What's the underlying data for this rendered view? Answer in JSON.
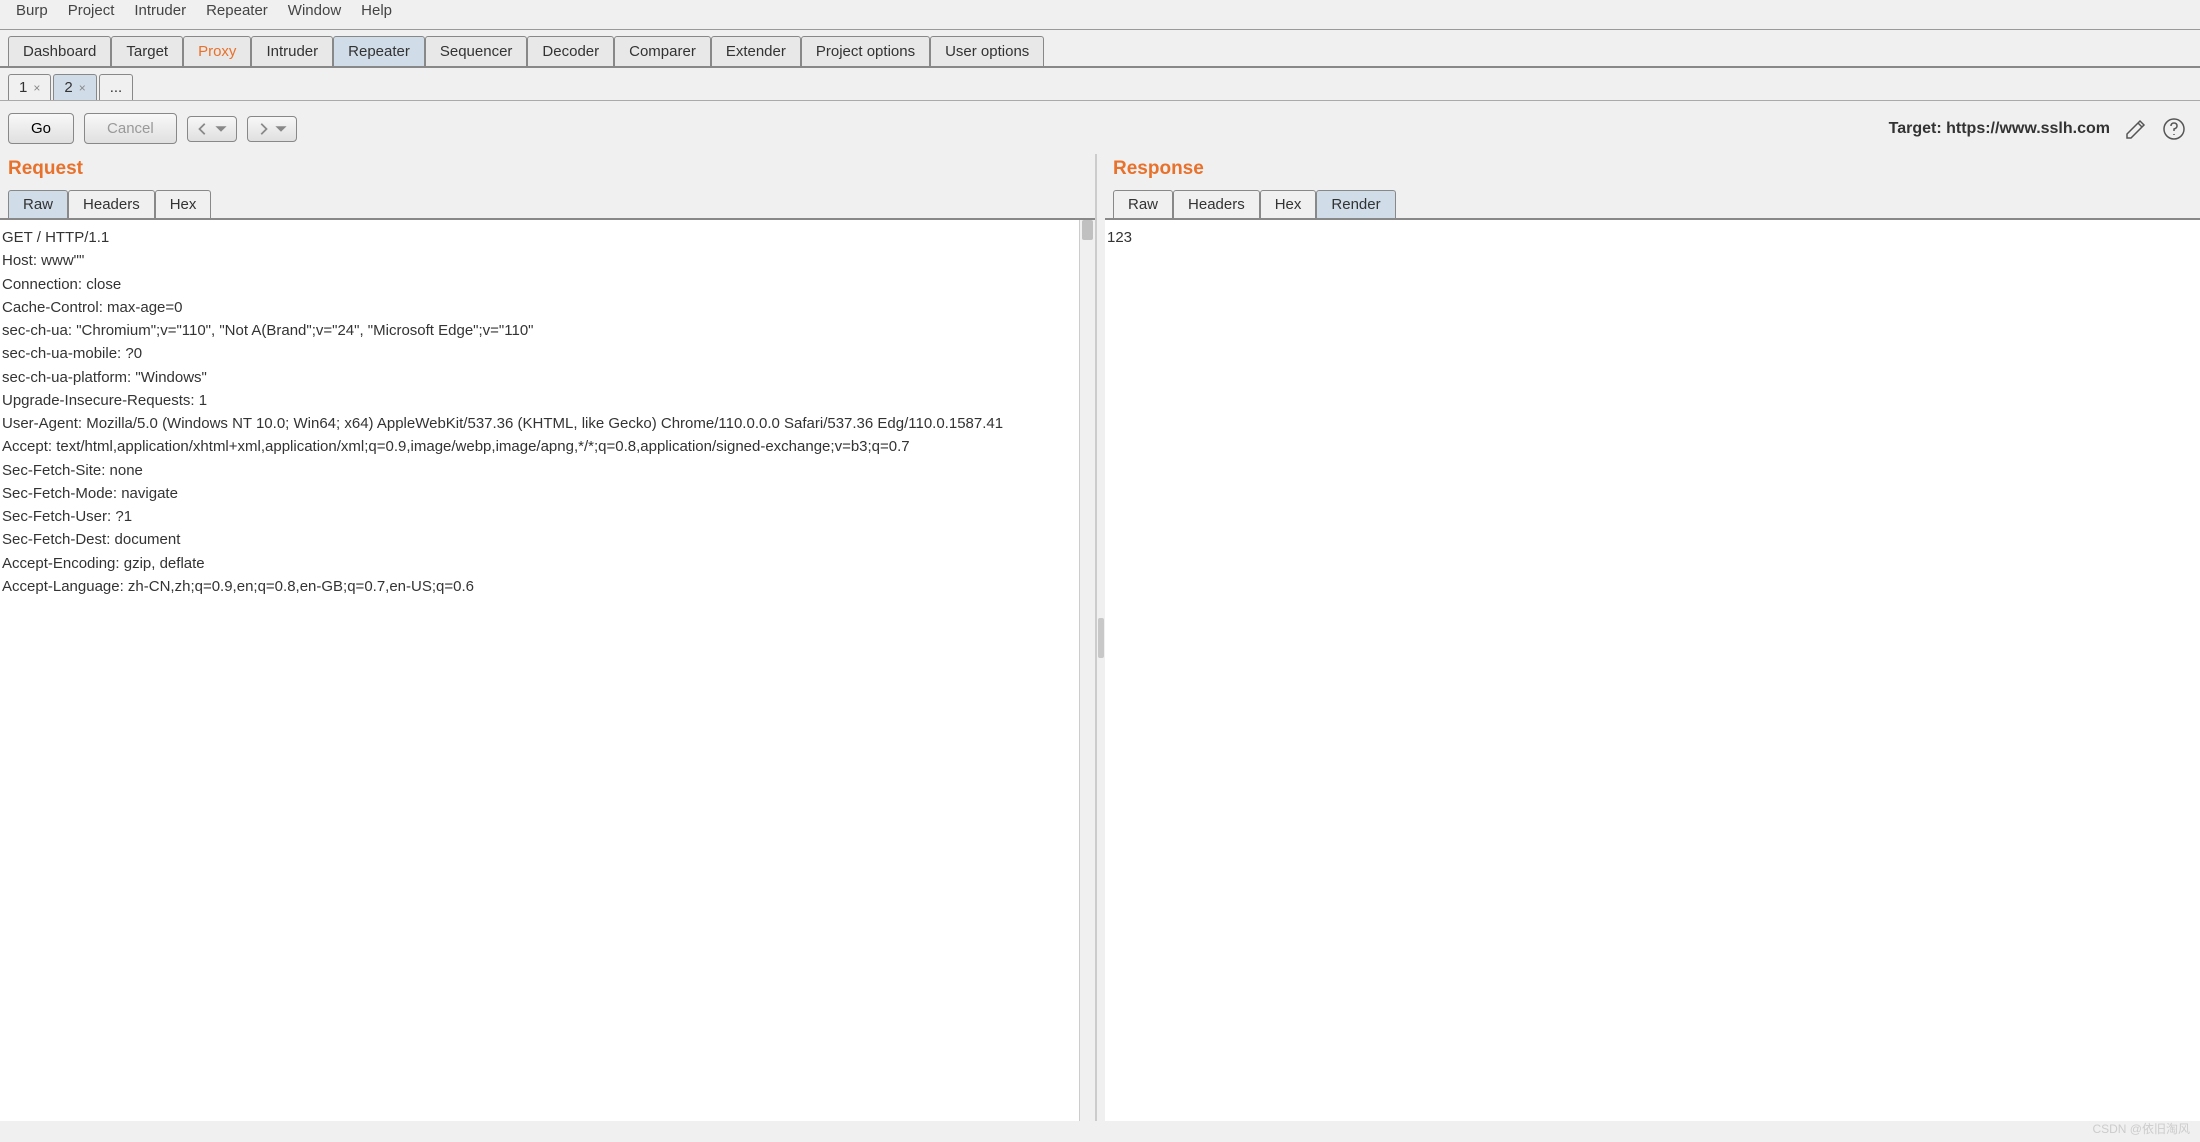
{
  "menubar": [
    "Burp",
    "Project",
    "Intruder",
    "Repeater",
    "Window",
    "Help"
  ],
  "main_tabs": {
    "items": [
      "Dashboard",
      "Target",
      "Proxy",
      "Intruder",
      "Repeater",
      "Sequencer",
      "Decoder",
      "Comparer",
      "Extender",
      "Project options",
      "User options"
    ],
    "orange_index": 2,
    "blue_index": 4
  },
  "sub_tabs": {
    "items": [
      "1",
      "2",
      "..."
    ],
    "active_index": 1
  },
  "toolbar": {
    "go": "Go",
    "cancel": "Cancel",
    "target_label": "Target: https://www.sslh.com"
  },
  "request": {
    "title": "Request",
    "view_tabs": [
      "Raw",
      "Headers",
      "Hex"
    ],
    "active_view": 0,
    "body": "GET / HTTP/1.1\nHost: www\"\"\nConnection: close\nCache-Control: max-age=0\nsec-ch-ua: \"Chromium\";v=\"110\", \"Not A(Brand\";v=\"24\", \"Microsoft Edge\";v=\"110\"\nsec-ch-ua-mobile: ?0\nsec-ch-ua-platform: \"Windows\"\nUpgrade-Insecure-Requests: 1\nUser-Agent: Mozilla/5.0 (Windows NT 10.0; Win64; x64) AppleWebKit/537.36 (KHTML, like Gecko) Chrome/110.0.0.0 Safari/537.36 Edg/110.0.1587.41\nAccept: text/html,application/xhtml+xml,application/xml;q=0.9,image/webp,image/apng,*/*;q=0.8,application/signed-exchange;v=b3;q=0.7\nSec-Fetch-Site: none\nSec-Fetch-Mode: navigate\nSec-Fetch-User: ?1\nSec-Fetch-Dest: document\nAccept-Encoding: gzip, deflate\nAccept-Language: zh-CN,zh;q=0.9,en;q=0.8,en-GB;q=0.7,en-US;q=0.6"
  },
  "response": {
    "title": "Response",
    "view_tabs": [
      "Raw",
      "Headers",
      "Hex",
      "Render"
    ],
    "active_view": 3,
    "body": "123"
  },
  "watermark": "CSDN @依旧淘风"
}
